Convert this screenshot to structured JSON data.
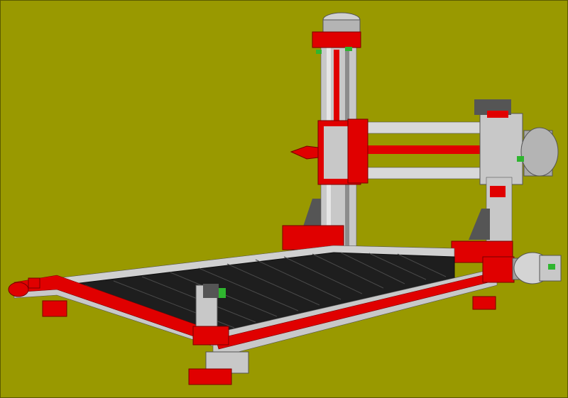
{
  "viewport": {
    "background": "#999900",
    "frame_border": "#5a5a00"
  },
  "model": {
    "accent_red": "#e00000",
    "dark_red": "#9a0000",
    "aluminum": "#c8c8c8",
    "aluminum_light": "#e6e6e6",
    "aluminum_dark": "#8c8c8c",
    "bed_slats": "#1e1e1e",
    "bed_dark": "#0e0e0e",
    "green_accent": "#2fb52f",
    "motor_grey": "#b4b4b4"
  },
  "icons": {
    "torch": "torch-icon",
    "stepper_motor": "stepper-motor-icon"
  }
}
